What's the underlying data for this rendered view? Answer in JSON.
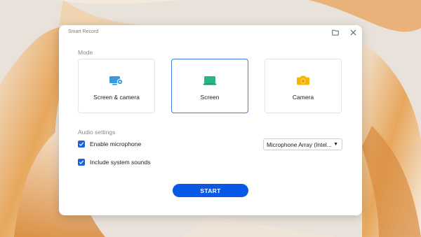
{
  "window": {
    "title": "Smart Record"
  },
  "mode": {
    "label": "Mode",
    "options": [
      {
        "label": "Screen & camera",
        "icon": "screen-camera-icon",
        "selected": false
      },
      {
        "label": "Screen",
        "icon": "screen-icon",
        "selected": true
      },
      {
        "label": "Camera",
        "icon": "camera-icon",
        "selected": false
      }
    ]
  },
  "audio": {
    "label": "Audio settings",
    "enable_microphone": {
      "label": "Enable microphone",
      "checked": true
    },
    "include_system_sounds": {
      "label": "Include system sounds",
      "checked": true
    },
    "microphone_select": {
      "value": "Microphone Array (Intel..."
    }
  },
  "start_label": "START",
  "colors": {
    "accent": "#0a59e6",
    "selected_border": "#3d7fe0",
    "screen_icon": "#29b58a",
    "camera_icon": "#f7b500",
    "screen_camera_icon": "#3d9ad9"
  }
}
